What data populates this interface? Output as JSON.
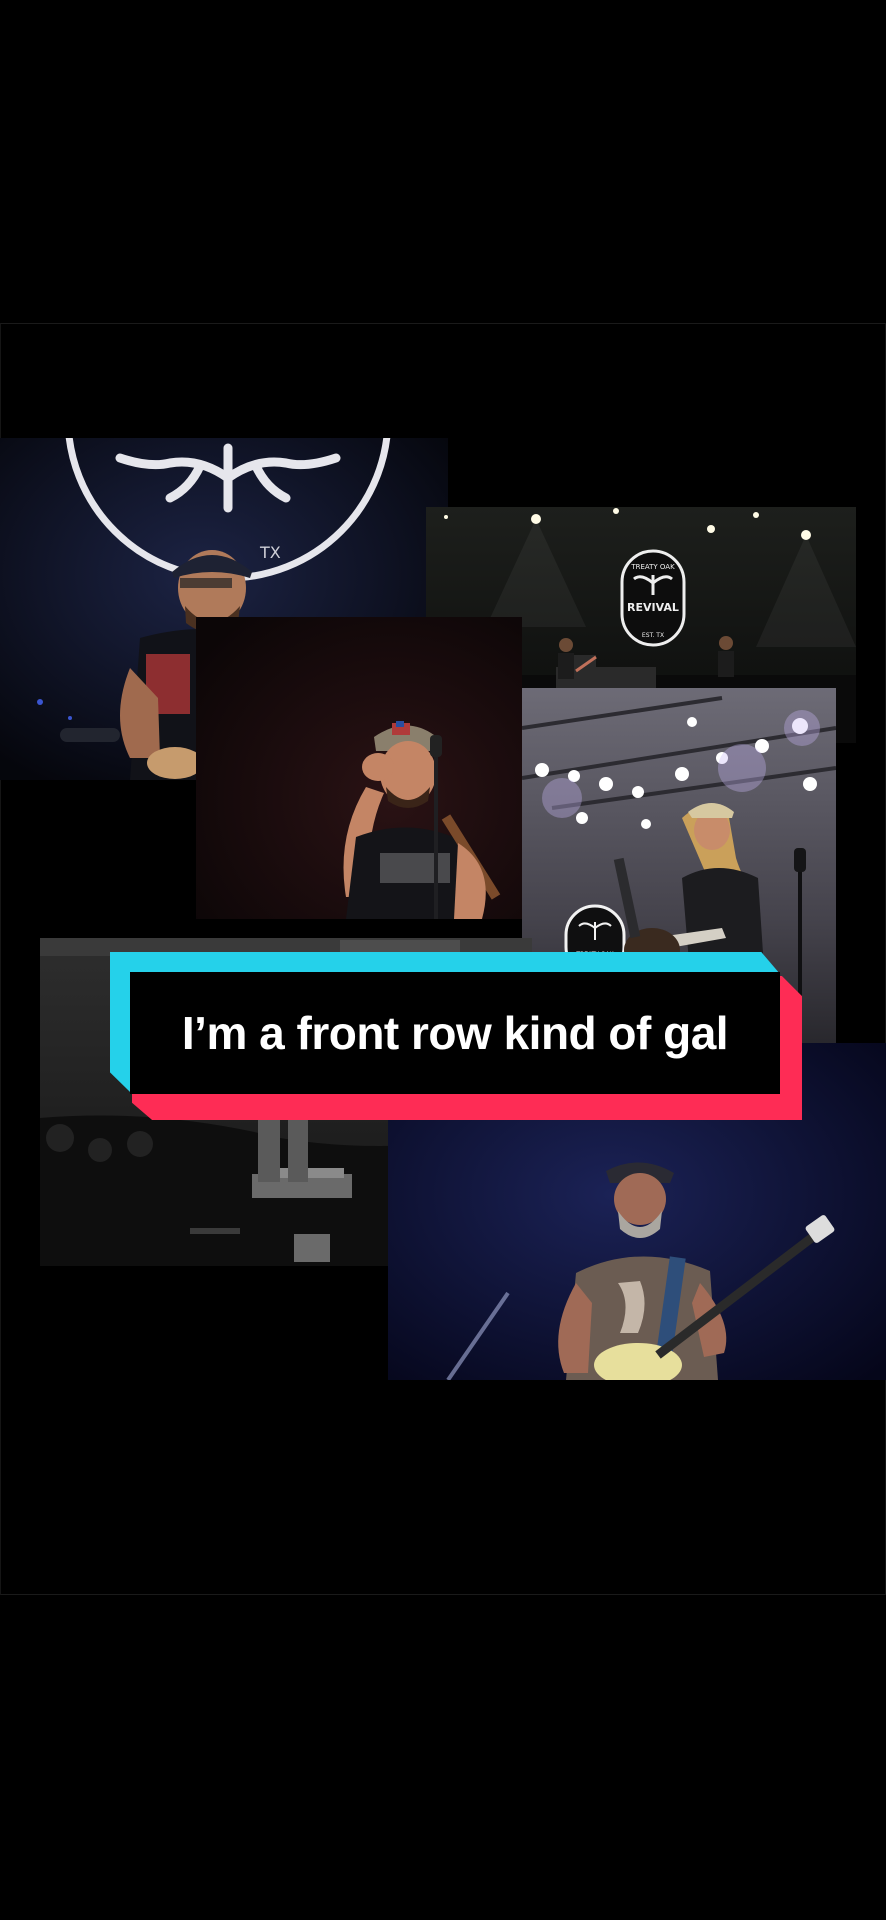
{
  "caption": {
    "text": "I’m a front row kind of gal"
  },
  "colors": {
    "background": "#000000",
    "caption_cyan": "#25d1ea",
    "caption_red": "#fe2c55",
    "caption_text": "#ffffff"
  },
  "photos": [
    {
      "name": "singer-laughing-logo-backdrop-photo"
    },
    {
      "name": "stage-wide-shot-treaty-oak-revival-photo"
    },
    {
      "name": "singer-tipping-hat-photo"
    },
    {
      "name": "guitarist-stage-lights-photo"
    },
    {
      "name": "black-and-white-crowd-photo"
    },
    {
      "name": "bearded-guitarist-blue-light-photo"
    }
  ],
  "logo": {
    "line1": "TREATY OAK",
    "line2": "REVIVAL",
    "line3": "EST. TX"
  }
}
